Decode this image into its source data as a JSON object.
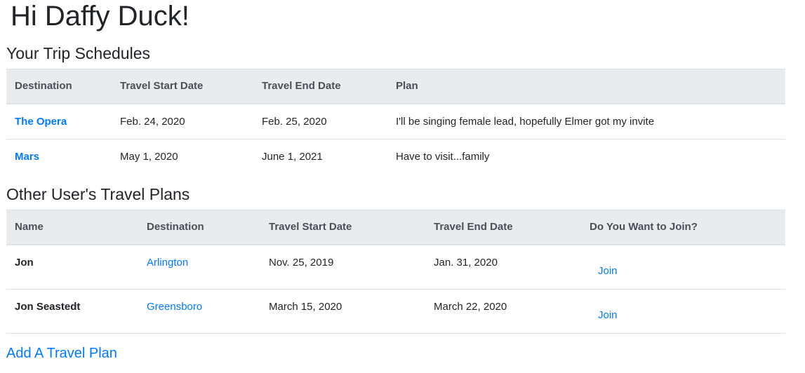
{
  "greeting": "Hi Daffy Duck!",
  "trips": {
    "heading": "Your Trip Schedules",
    "columns": [
      "Destination",
      "Travel Start Date",
      "Travel End Date",
      "Plan"
    ],
    "rows": [
      {
        "destination": "The Opera",
        "start": "Feb. 24, 2020",
        "end": "Feb. 25, 2020",
        "plan": "I'll be singing female lead, hopefully Elmer got my invite"
      },
      {
        "destination": "Mars",
        "start": "May 1, 2020",
        "end": "June 1, 2021",
        "plan": "Have to visit...family"
      }
    ]
  },
  "others": {
    "heading": "Other User's Travel Plans",
    "columns": [
      "Name",
      "Destination",
      "Travel Start Date",
      "Travel End Date",
      "Do You Want to Join?"
    ],
    "rows": [
      {
        "name": "Jon",
        "destination": "Arlington",
        "start": "Nov. 25, 2019",
        "end": "Jan. 31, 2020",
        "join": "Join"
      },
      {
        "name": "Jon Seastedt",
        "destination": "Greensboro",
        "start": "March 15, 2020",
        "end": "March 22, 2020",
        "join": "Join"
      }
    ]
  },
  "add_plan_label": "Add A Travel Plan",
  "colors": {
    "link": "#007bff",
    "header_bg": "#e9ecef"
  }
}
